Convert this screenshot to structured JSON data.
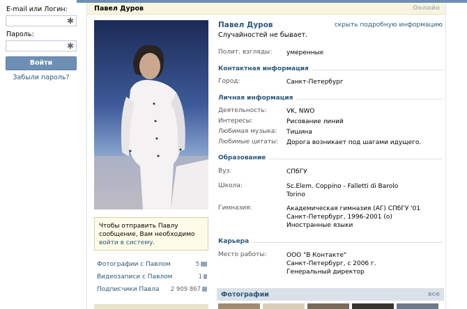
{
  "login": {
    "email_label": "E-mail или Логин:",
    "password_label": "Пароль:",
    "field_marker": "✱",
    "login_button": "Войти",
    "forgot": "Забыли пароль?"
  },
  "header": {
    "name": "Павел Дуров",
    "online": "Онлайн"
  },
  "profile": {
    "name": "Павел Дуров",
    "status": "Случайностей не бывает.",
    "hide_details": "скрыть подробную информацию",
    "basic": [
      {
        "key": "Полит. взгляды:",
        "value": "умеренные"
      }
    ],
    "contacts_title": "Контактная информация",
    "contacts": [
      {
        "key": "Город:",
        "value": "Санкт-Петербург"
      }
    ],
    "personal_title": "Личная информация",
    "personal": [
      {
        "key": "Деятельность:",
        "value": "VK, NWO"
      },
      {
        "key": "Интересы:",
        "value": "Рисование линий"
      },
      {
        "key": "Любимая музыка:",
        "value": "Тишина"
      },
      {
        "key": "Любимые цитаты:",
        "value": "Дорога возникает под шагами идущего."
      }
    ],
    "education_title": "Образование",
    "education": [
      {
        "key": "Вуз:",
        "value": "СПбГУ"
      },
      {
        "key": "Школа:",
        "value_1": "Sc.Elem. Coppino - Falletti di Barolo",
        "value_2": "Torino"
      },
      {
        "key": "Гимназия:",
        "value_1": "Академическая гимназия (АГ) СПбГУ '01",
        "value_2": "Санкт-Петербург, 1996-2001 (о)",
        "value_3": "Иностранные языки"
      }
    ],
    "career_title": "Карьера",
    "career": [
      {
        "key": "Место работы:",
        "value_1": "ООО \"В Контакте\"",
        "value_2": "Санкт-Петербург, с 2006 г.",
        "value_3": "Генеральный директор"
      }
    ]
  },
  "message_box": {
    "text": "Чтобы отправить Павлу сообщение, Вам необходимо ",
    "link": "войти в систему",
    "end": "."
  },
  "side_links": [
    {
      "label": "Фотографии с Павлом",
      "count": "5"
    },
    {
      "label": "Видеозаписи с Павлом",
      "count": "1"
    },
    {
      "label": "Подписчики Павла",
      "count": "2 909 867"
    }
  ],
  "photos": {
    "title": "Фотографии",
    "all": "все"
  },
  "colors": {
    "accent": "#2b587a",
    "button": "#6d8fb3",
    "header_bg": "#f7f4e0"
  }
}
